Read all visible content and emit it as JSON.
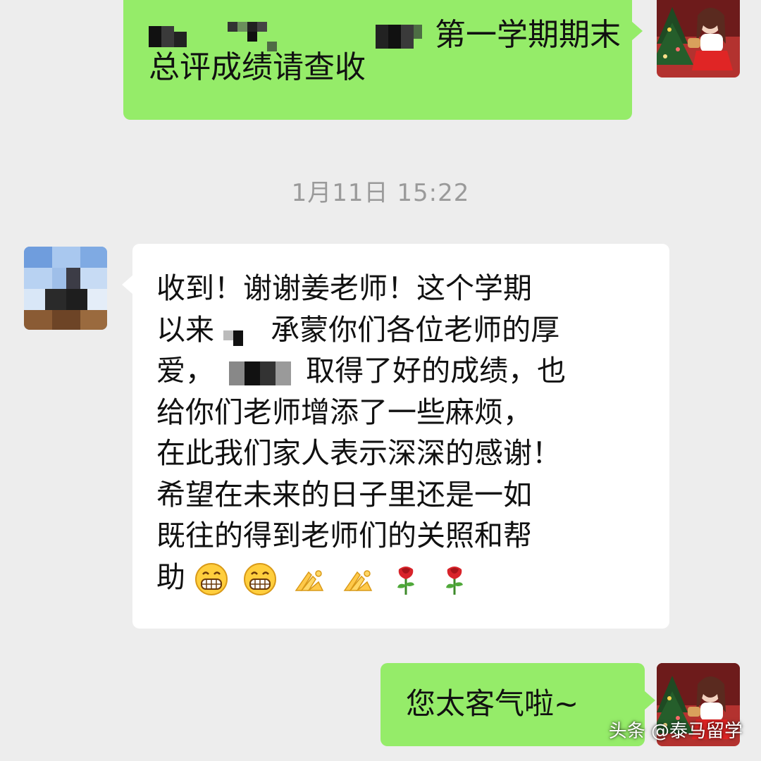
{
  "chat": {
    "messages": [
      {
        "direction": "sent",
        "lines": [
          "第一学期期末",
          "总评成绩请查收"
        ]
      },
      {
        "direction": "received",
        "rows": [
          "收到！谢谢姜老师！这个学期",
          "以来",
          "承蒙你们各位老师的厚",
          "爱，",
          "取得了好的成绩，也",
          "给你们老师增添了一些麻烦，",
          "在此我们家人表示深深的感谢！",
          "希望在未来的日子里还是一如",
          "既往的得到老师们的关照和帮",
          "助"
        ],
        "emojis": [
          "grin-emoji",
          "grin-emoji",
          "pray-hands-emoji",
          "pray-hands-emoji",
          "rose-emoji",
          "rose-emoji"
        ]
      },
      {
        "direction": "sent",
        "text": "您太客气啦~"
      }
    ],
    "timestamp": "1月11日 15:22"
  },
  "watermark": "头条 @泰马留学",
  "colors": {
    "background": "#ededed",
    "sent_bubble": "#95ec69",
    "received_bubble": "#ffffff",
    "timestamp_text": "#9a9a9a"
  }
}
